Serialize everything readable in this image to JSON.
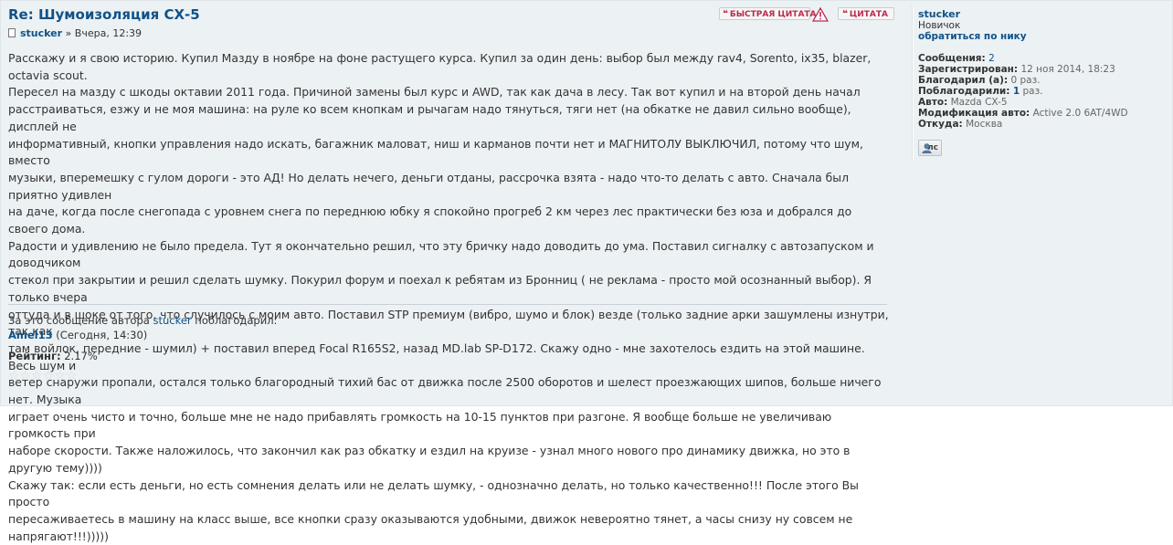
{
  "post": {
    "title": "Re: Шумоизоляция СХ-5",
    "author": "stucker",
    "date_sep": " » ",
    "date": "Вчера, 12:39",
    "buttons": {
      "fast_quote": "БЫСТРАЯ ЦИТАТА",
      "quote": "ЦИТАТА"
    },
    "lines": [
      "Расскажу и я свою историю. Купил Мазду в ноябре на фоне растущего курса. Купил за один день: выбор был между rav4, Sorento, ix35, blazer, octavia scout.",
      "Пересел на мазду с шкоды октавии 2011 года. Причиной замены был курс и AWD, так как дача в лесу. Так вот купил и на второй день начал",
      "расстраиваться, езжу и не моя машина: на руле ко всем кнопкам и рычагам надо тянуться, тяги нет (на обкатке не давил сильно вообще), дисплей не",
      "информативный, кнопки управления надо искать, багажник маловат, ниш и карманов почти нет и МАГНИТОЛУ ВЫКЛЮЧИЛ, потому что шум, вместо",
      "музыки, вперемешку с гулом дороги - это АД! Но делать нечего, деньги отданы, рассрочка взята - надо что-то делать с авто. Сначала был приятно удивлен",
      "на даче, когда после снегопада с уровнем снега по переднюю юбку я спокойно прогреб 2 км через лес практически без юза и добрался до своего дома.",
      "Радости и удивлению не было предела. Тут я окончательно решил, что эту бричку надо доводить до ума. Поставил сигналку с автозапуском и доводчиком",
      "стекол при закрытии и решил сделать шумку. Покурил форум и поехал к ребятам из Бронниц ( не реклама - просто мой осознанный выбор). Я только вчера",
      "оттуда и в шоке от того, что случилось с моим авто. Поставил STP премиум (вибро, шумо и блок) везде (только задние арки зашумлены изнутри, так как",
      "там войлок, передние - шумил) + поставил вперед Focal R165S2, назад MD.lab SP-D172. Скажу одно - мне захотелось ездить на этой машине. Весь шум и",
      "ветер снаружи пропали, остался только благородный тихий бас от движка после 2500 оборотов и шелест проезжающих шипов, больше ничего нет. Музыка",
      "играет очень чисто и точно, больше мне не надо прибавлять громкость на 10-15 пунктов при разгоне. Я вообще больше не увеличиваю громкость при",
      "наборе скорости. Также наложилось, что закончил как раз обкатку и ездил на круизе - узнал много нового про динамику движка, но это в другую тему))))",
      "Скажу так: если есть деньги, но есть сомнения делать или не делать шумку, - однозначно делать, но только качественно!!! После этого Вы просто",
      "пересаживаетесь в машину на класс выше, все кнопки сразу оказываются удобными, движок невероятно тянет, а часы снизу ну совсем не напрягают!!!)))))"
    ],
    "thanks": {
      "prefix": "За это сообщение автора ",
      "author": "stucker",
      "suffix": " поблагодарил:",
      "user": "Amel13",
      "when": " (Сегодня, 14:30)"
    },
    "rating": {
      "label": "Рейтинг:",
      "value": "2.17%",
      "stars_filled": 0,
      "stars_total": 6
    }
  },
  "profile": {
    "username": "stucker",
    "rank": "Новичок",
    "contact": "обратиться по нику",
    "fields": {
      "posts_label": "Сообщения:",
      "posts": "2",
      "registered_label": "Зарегистрирован:",
      "registered": "12 ноя 2014, 18:23",
      "thanked_label": "Благодарил (а):",
      "thanked": "0 раз.",
      "was_thanked_label": "Поблагодарили:",
      "was_thanked": "1",
      "was_thanked_suffix": " раз.",
      "car_label": "Авто:",
      "car": "Mazda CX-5",
      "mod_label": "Модификация авто:",
      "mod": "Active 2.0 6AT/4WD",
      "from_label": "Откуда:",
      "from": "Москва"
    },
    "pm_button": "лс"
  },
  "colors": {
    "background": "#ecf1f3",
    "link": "#105289",
    "button_text": "#bc2a4d",
    "text": "#333333"
  }
}
